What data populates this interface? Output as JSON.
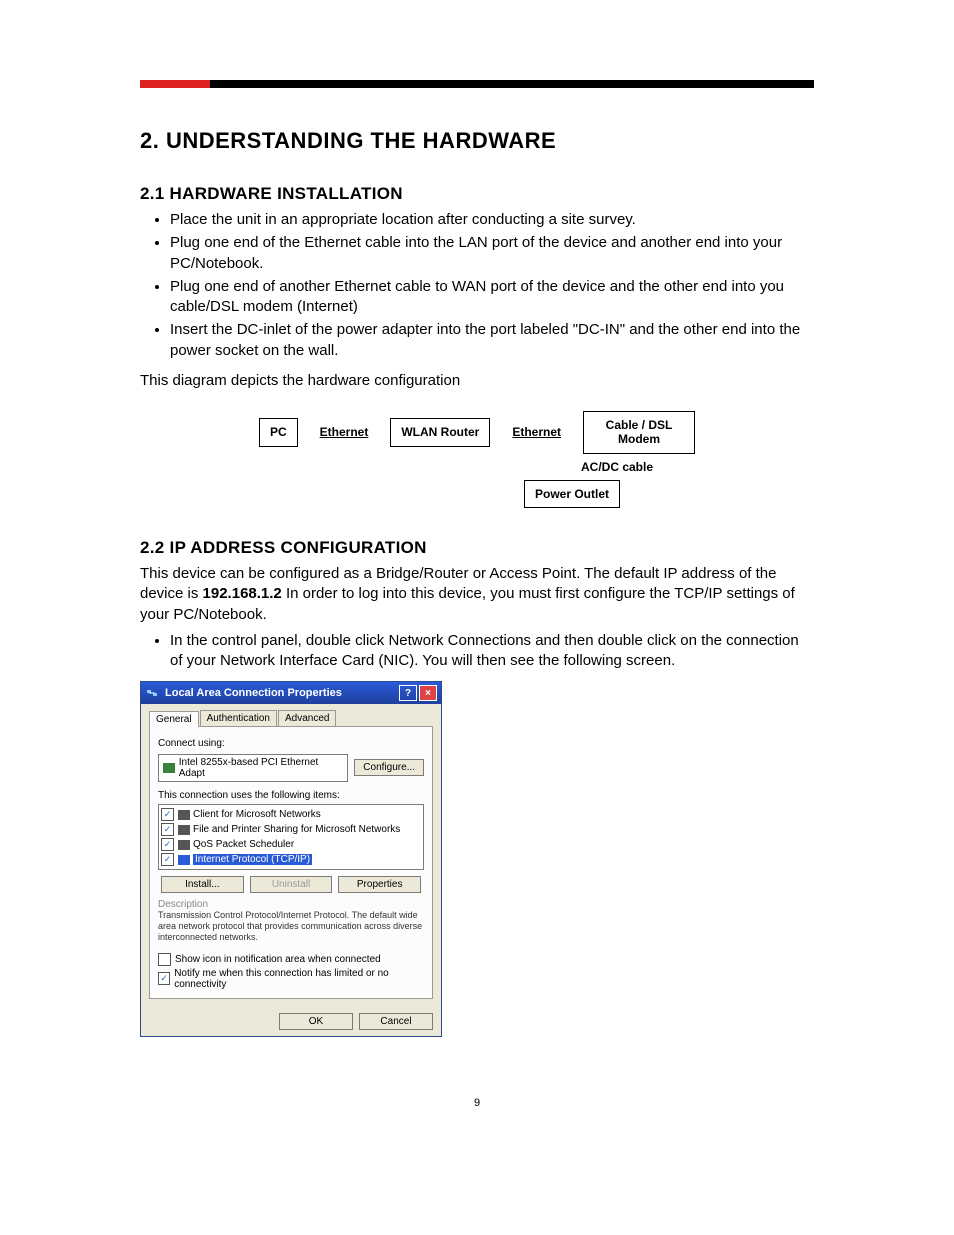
{
  "h1": "2.  UNDERSTANDING THE HARDWARE",
  "section21": {
    "heading": "2.1  HARDWARE INSTALLATION",
    "bullets": [
      "Place the unit in an appropriate location after conducting a site survey.",
      "Plug one end of the Ethernet cable into the LAN port of the device and another end into your PC/Notebook.",
      "Plug one end of another Ethernet cable to WAN port of the device and the other end into you cable/DSL modem (Internet)",
      "Insert the DC-inlet of the power adapter into the port labeled \"DC-IN\" and the other end into the power socket on the wall."
    ],
    "caption": "This diagram depicts the hardware configuration"
  },
  "diagram": {
    "pc": "PC",
    "eth1": "Ethernet",
    "wlan": "WLAN Router",
    "eth2": "Ethernet",
    "modem": "Cable / DSL Modem",
    "acdc": "AC/DC cable",
    "outlet": "Power Outlet"
  },
  "section22": {
    "heading": "2.2  IP ADDRESS CONFIGURATION",
    "para1a": "This device can be configured as a Bridge/Router or Access Point.  The default IP address of the device is ",
    "ip": "192.168.1.2",
    "para1b": " In order to log into this device, you must first configure the TCP/IP settings of your PC/Notebook.",
    "bullet": "In the control panel, double click Network Connections and then double click on the connection of your Network Interface Card (NIC). You will then see the following screen."
  },
  "dialog": {
    "title": "Local Area Connection Properties",
    "tabs": {
      "general": "General",
      "auth": "Authentication",
      "adv": "Advanced"
    },
    "connect_using": "Connect using:",
    "adapter": "Intel 8255x-based PCI Ethernet Adapt",
    "configure": "Configure...",
    "items_label": "This connection uses the following items:",
    "items": [
      "Client for Microsoft Networks",
      "File and Printer Sharing for Microsoft Networks",
      "QoS Packet Scheduler",
      "Internet Protocol (TCP/IP)"
    ],
    "install": "Install...",
    "uninstall": "Uninstall",
    "properties": "Properties",
    "desc_label": "Description",
    "desc_text": "Transmission Control Protocol/Internet Protocol. The default wide area network protocol that provides communication across diverse interconnected networks.",
    "show_icon": "Show icon in notification area when connected",
    "notify": "Notify me when this connection has limited or no connectivity",
    "ok": "OK",
    "cancel": "Cancel"
  },
  "page_number": "9"
}
